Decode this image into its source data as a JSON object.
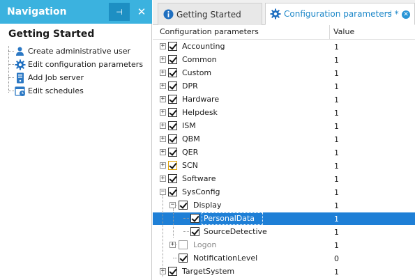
{
  "navigation": {
    "title": "Navigation",
    "pin_glyph": "⊣",
    "close_glyph": "✕",
    "section_title": "Getting Started",
    "items": [
      {
        "label": "Create administrative user",
        "icon": "user-icon"
      },
      {
        "label": "Edit configuration parameters",
        "icon": "gear-icon"
      },
      {
        "label": "Add Job server",
        "icon": "server-icon"
      },
      {
        "label": "Edit schedules",
        "icon": "calendar-icon"
      }
    ]
  },
  "tabs": [
    {
      "label": "Getting Started",
      "icon": "info-icon",
      "active": false
    },
    {
      "label": "Configuration parameters *",
      "icon": "gear-icon",
      "active": true,
      "pin_glyph": "⊣",
      "close_glyph": "✕"
    }
  ],
  "grid": {
    "columns": [
      "Configuration parameters",
      "Value"
    ],
    "rows": [
      {
        "label": "Accounting",
        "value": "1",
        "level": 0,
        "expander": "+",
        "checked": true
      },
      {
        "label": "Common",
        "value": "1",
        "level": 0,
        "expander": "+",
        "checked": true
      },
      {
        "label": "Custom",
        "value": "1",
        "level": 0,
        "expander": "+",
        "checked": true
      },
      {
        "label": "DPR",
        "value": "1",
        "level": 0,
        "expander": "+",
        "checked": true
      },
      {
        "label": "Hardware",
        "value": "1",
        "level": 0,
        "expander": "+",
        "checked": true
      },
      {
        "label": "Helpdesk",
        "value": "1",
        "level": 0,
        "expander": "+",
        "checked": true
      },
      {
        "label": "ISM",
        "value": "1",
        "level": 0,
        "expander": "+",
        "checked": true
      },
      {
        "label": "QBM",
        "value": "1",
        "level": 0,
        "expander": "+",
        "checked": true
      },
      {
        "label": "QER",
        "value": "1",
        "level": 0,
        "expander": "+",
        "checked": true
      },
      {
        "label": "SCN",
        "value": "1",
        "level": 0,
        "expander": "+",
        "checked": true
      },
      {
        "label": "Software",
        "value": "1",
        "level": 0,
        "expander": "+",
        "checked": true
      },
      {
        "label": "SysConfig",
        "value": "1",
        "level": 0,
        "expander": "−",
        "checked": true
      },
      {
        "label": "Display",
        "value": "1",
        "level": 1,
        "expander": "−",
        "checked": true
      },
      {
        "label": "PersonalData",
        "value": "1",
        "level": 2,
        "expander": "",
        "checked": true
      },
      {
        "label": "SourceDetective",
        "value": "1",
        "level": 2,
        "expander": "",
        "checked": true
      },
      {
        "label": "Logon",
        "value": "1",
        "level": 1,
        "expander": "+",
        "checked": false
      },
      {
        "label": "NotificationLevel",
        "value": "0",
        "level": 1,
        "expander": "",
        "checked": true
      },
      {
        "label": "TargetSystem",
        "value": "1",
        "level": 0,
        "expander": "+",
        "checked": true
      }
    ]
  },
  "colors": {
    "nav_header": "#3bb2df",
    "selection": "#1e7fd6",
    "active_tab_text": "#1e88c9"
  }
}
